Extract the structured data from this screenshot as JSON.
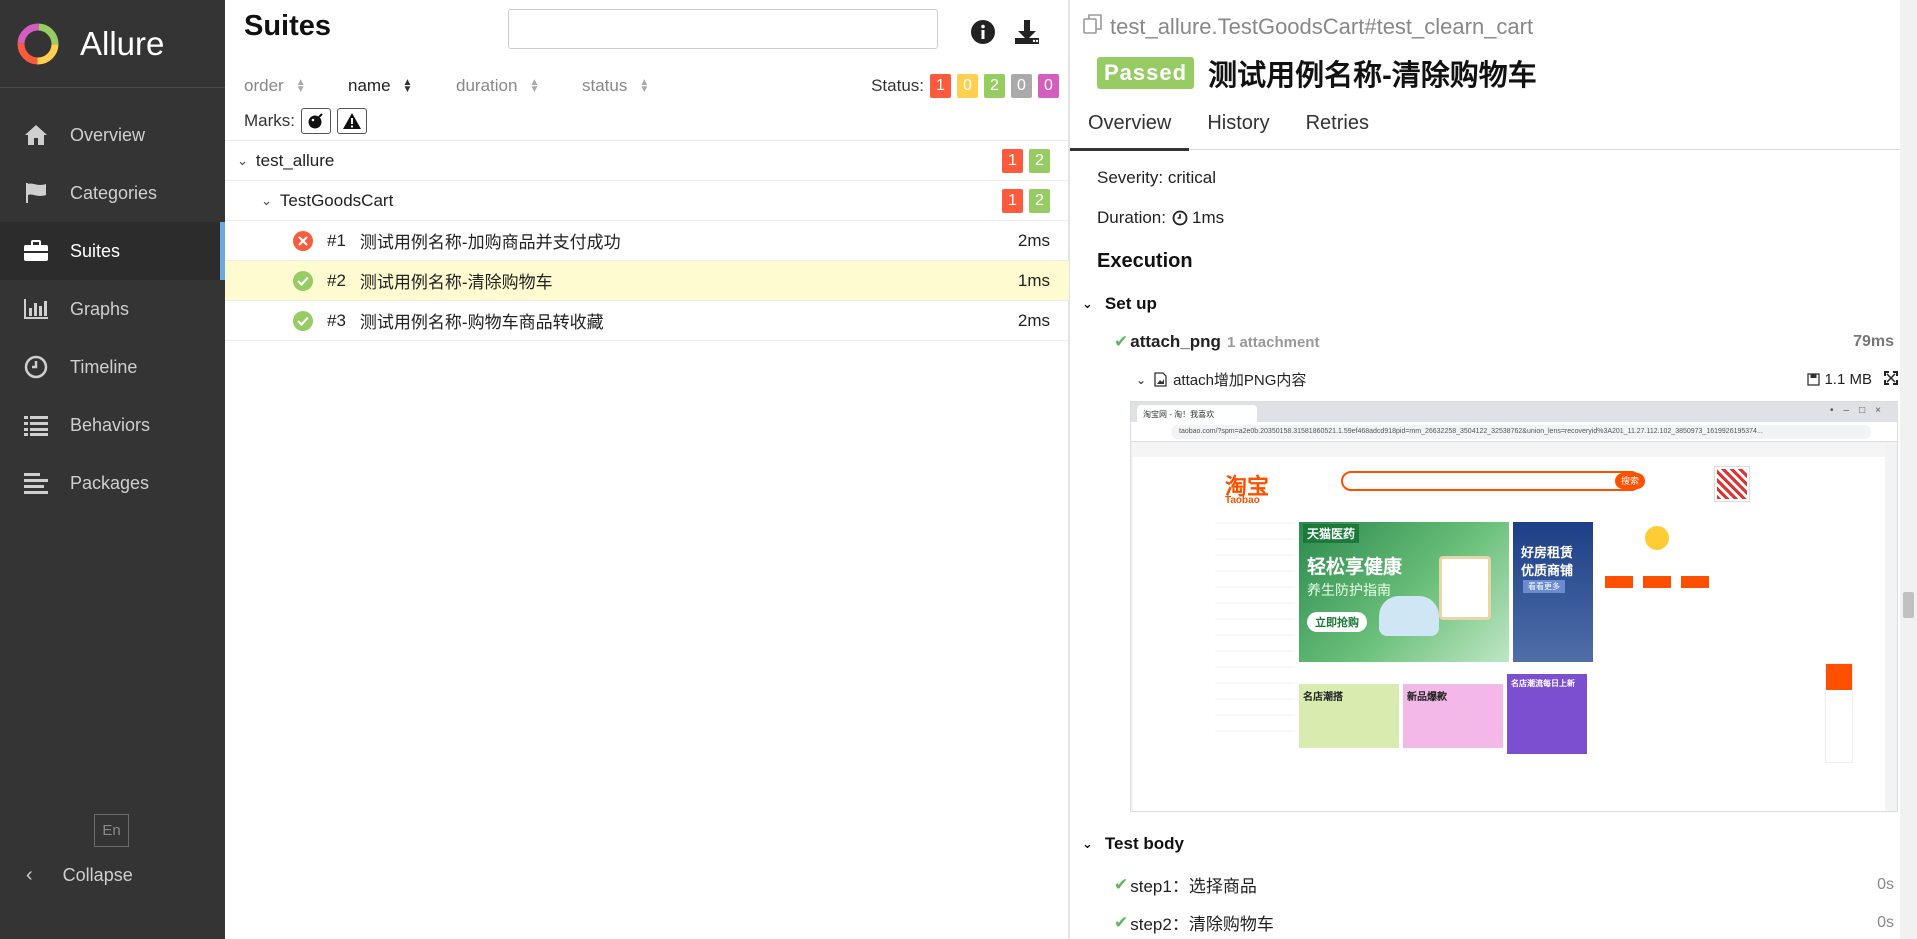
{
  "brand": {
    "name": "Allure"
  },
  "sidebar": {
    "items": [
      {
        "label": "Overview",
        "icon": "home-icon"
      },
      {
        "label": "Categories",
        "icon": "flag-icon"
      },
      {
        "label": "Suites",
        "icon": "briefcase-icon",
        "active": true
      },
      {
        "label": "Graphs",
        "icon": "bar-chart-icon"
      },
      {
        "label": "Timeline",
        "icon": "clock-icon"
      },
      {
        "label": "Behaviors",
        "icon": "list-icon"
      },
      {
        "label": "Packages",
        "icon": "align-left-icon"
      }
    ],
    "language": "En",
    "collapse_label": "Collapse"
  },
  "suites": {
    "title": "Suites",
    "search": {
      "value": "",
      "placeholder": ""
    },
    "sort": {
      "order": "order",
      "name": "name",
      "duration": "duration",
      "status": "status"
    },
    "status_label": "Status:",
    "status_counts": [
      "1",
      "0",
      "2",
      "0",
      "0"
    ],
    "marks_label": "Marks:",
    "tree": {
      "suite": {
        "name": "test_allure",
        "failed": "1",
        "passed": "2"
      },
      "class": {
        "name": "TestGoodsCart",
        "failed": "1",
        "passed": "2"
      },
      "cases": [
        {
          "num": "#1",
          "name": "测试用例名称-加购商品并支付成功",
          "duration": "2ms",
          "status": "failed"
        },
        {
          "num": "#2",
          "name": "测试用例名称-清除购物车",
          "duration": "1ms",
          "status": "passed"
        },
        {
          "num": "#3",
          "name": "测试用例名称-购物车商品转收藏",
          "duration": "2ms",
          "status": "passed"
        }
      ]
    }
  },
  "detail": {
    "crumb": "test_allure.TestGoodsCart#test_clearn_cart",
    "status": "Passed",
    "title": "测试用例名称-清除购物车",
    "tabs": [
      "Overview",
      "History",
      "Retries"
    ],
    "severity": "Severity: critical",
    "duration_label": "Duration:",
    "duration_value": "1ms",
    "execution": "Execution",
    "setup": {
      "label": "Set up",
      "step": {
        "name": "attach_png",
        "meta": "1 attachment",
        "time": "79ms"
      },
      "attachment": {
        "name": "attach增加PNG内容",
        "size": "1.1 MB"
      }
    },
    "body": {
      "label": "Test body",
      "steps": [
        {
          "name": "step1：选择商品",
          "time": "0s"
        },
        {
          "name": "step2：清除购物车",
          "time": "0s"
        }
      ]
    },
    "screenshot": {
      "tab": "淘宝网 - 淘！我喜欢",
      "url": "taobao.com/?spm=a2e0b.20350158.31581860521.1.59ef468adcd918pid=mm_26632258_3504122_32538762&union_lens=recoveryid%3A201_11.27.112.102_3850973_1619926195374...",
      "logo_cn": "淘宝",
      "logo_en": "Taobao",
      "search_btn": "搜索",
      "banner_brand": "天猫医药",
      "banner_main": "轻松享健康",
      "banner_sub": "养生防护指南",
      "banner_btn": "立即抢购",
      "rent_line1": "好房租赁",
      "rent_line2": "优质商铺",
      "rent_btn": "看看更多",
      "cards": [
        "名店潮搭",
        "新品爆款",
        "名店潮流每日上新"
      ],
      "colors": {
        "orange": "#ff5000",
        "green": "#4caf50"
      }
    },
    "colors": {
      "failed": "#fd5a3e",
      "broken": "#ffd050",
      "passed": "#97cc64",
      "skipped": "#aaaaaa",
      "unknown": "#d35ebe"
    }
  }
}
